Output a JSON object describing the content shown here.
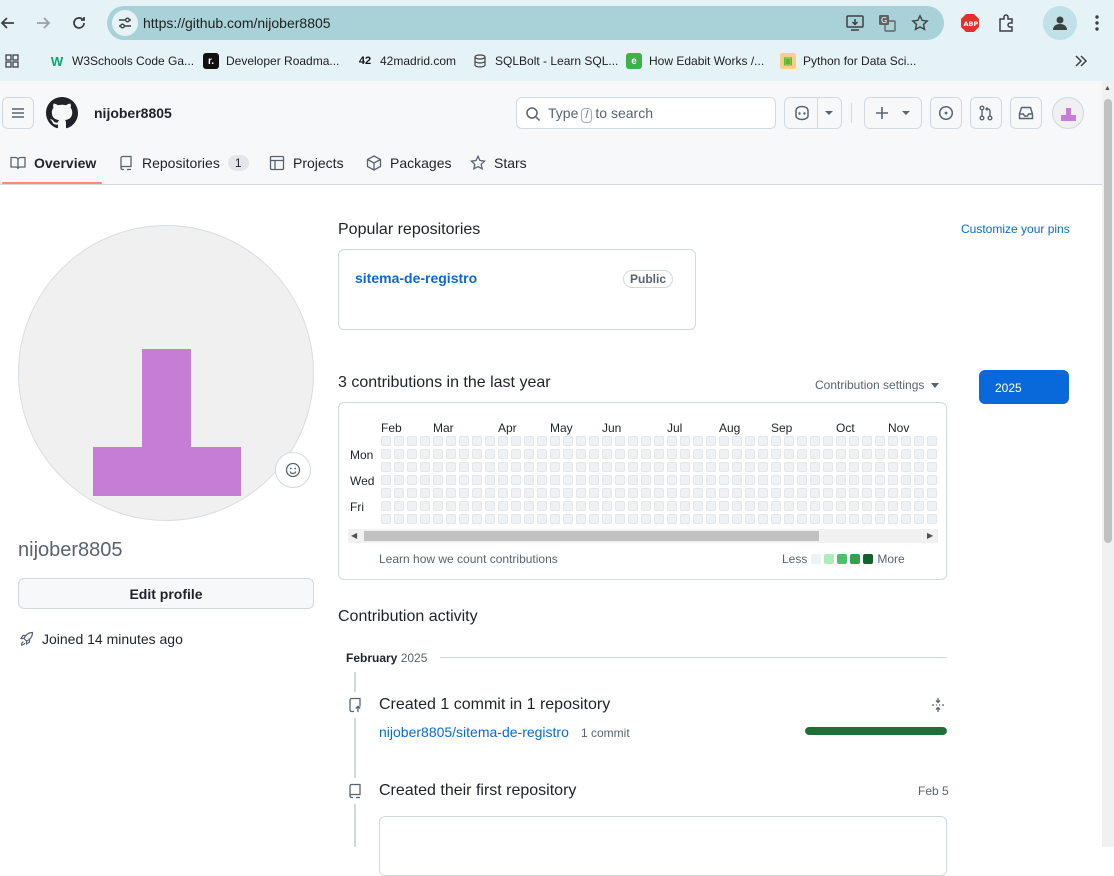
{
  "browser": {
    "url": "https://github.com/nijober8805",
    "bookmarks": [
      {
        "label": "W3Schools Code Ga...",
        "icon": "w3schools-icon"
      },
      {
        "label": "Developer Roadma...",
        "icon": "roadmap-icon"
      },
      {
        "label": "42madrid.com",
        "icon": "42-icon"
      },
      {
        "label": "SQLBolt - Learn SQL...",
        "icon": "database-icon"
      },
      {
        "label": "How Edabit Works /...",
        "icon": "edabit-icon"
      },
      {
        "label": "Python for Data Sci...",
        "icon": "python-icon"
      }
    ]
  },
  "header": {
    "username": "nijober8805",
    "search_type": "Type",
    "search_key": "/",
    "search_rest": "to search",
    "tabs": [
      {
        "label": "Overview",
        "icon": "book-icon"
      },
      {
        "label": "Repositories",
        "icon": "repo-icon",
        "count": "1"
      },
      {
        "label": "Projects",
        "icon": "table-icon"
      },
      {
        "label": "Packages",
        "icon": "package-icon"
      },
      {
        "label": "Stars",
        "icon": "star-icon"
      }
    ]
  },
  "profile": {
    "username": "nijober8805",
    "edit_label": "Edit profile",
    "joined": "Joined 14 minutes ago",
    "avatar_color": "#c67dd6"
  },
  "popular": {
    "title": "Popular repositories",
    "customize": "Customize your pins",
    "repo_name": "sitema-de-registro",
    "visibility": "Public"
  },
  "contributions": {
    "title": "3 contributions in the last year",
    "settings": "Contribution settings",
    "year": "2025",
    "months": [
      "Feb",
      "Mar",
      "Apr",
      "May",
      "Jun",
      "Jul",
      "Aug",
      "Sep",
      "Oct",
      "Nov"
    ],
    "days": [
      "Mon",
      "Wed",
      "Fri"
    ],
    "learn": "Learn how we count contributions",
    "less": "Less",
    "more": "More",
    "legend_colors": [
      "#eff2f5",
      "#aceebb",
      "#4ac26b",
      "#2da44e",
      "#116329"
    ]
  },
  "activity": {
    "title": "Contribution activity",
    "month": "February",
    "year": "2025",
    "commit_title": "Created 1 commit in 1 repository",
    "commit_repo": "nijober8805/sitema-de-registro",
    "commit_count": "1 commit",
    "commit_share": 1.0,
    "first_repo_title": "Created their first repository",
    "first_repo_date": "Feb 5"
  }
}
